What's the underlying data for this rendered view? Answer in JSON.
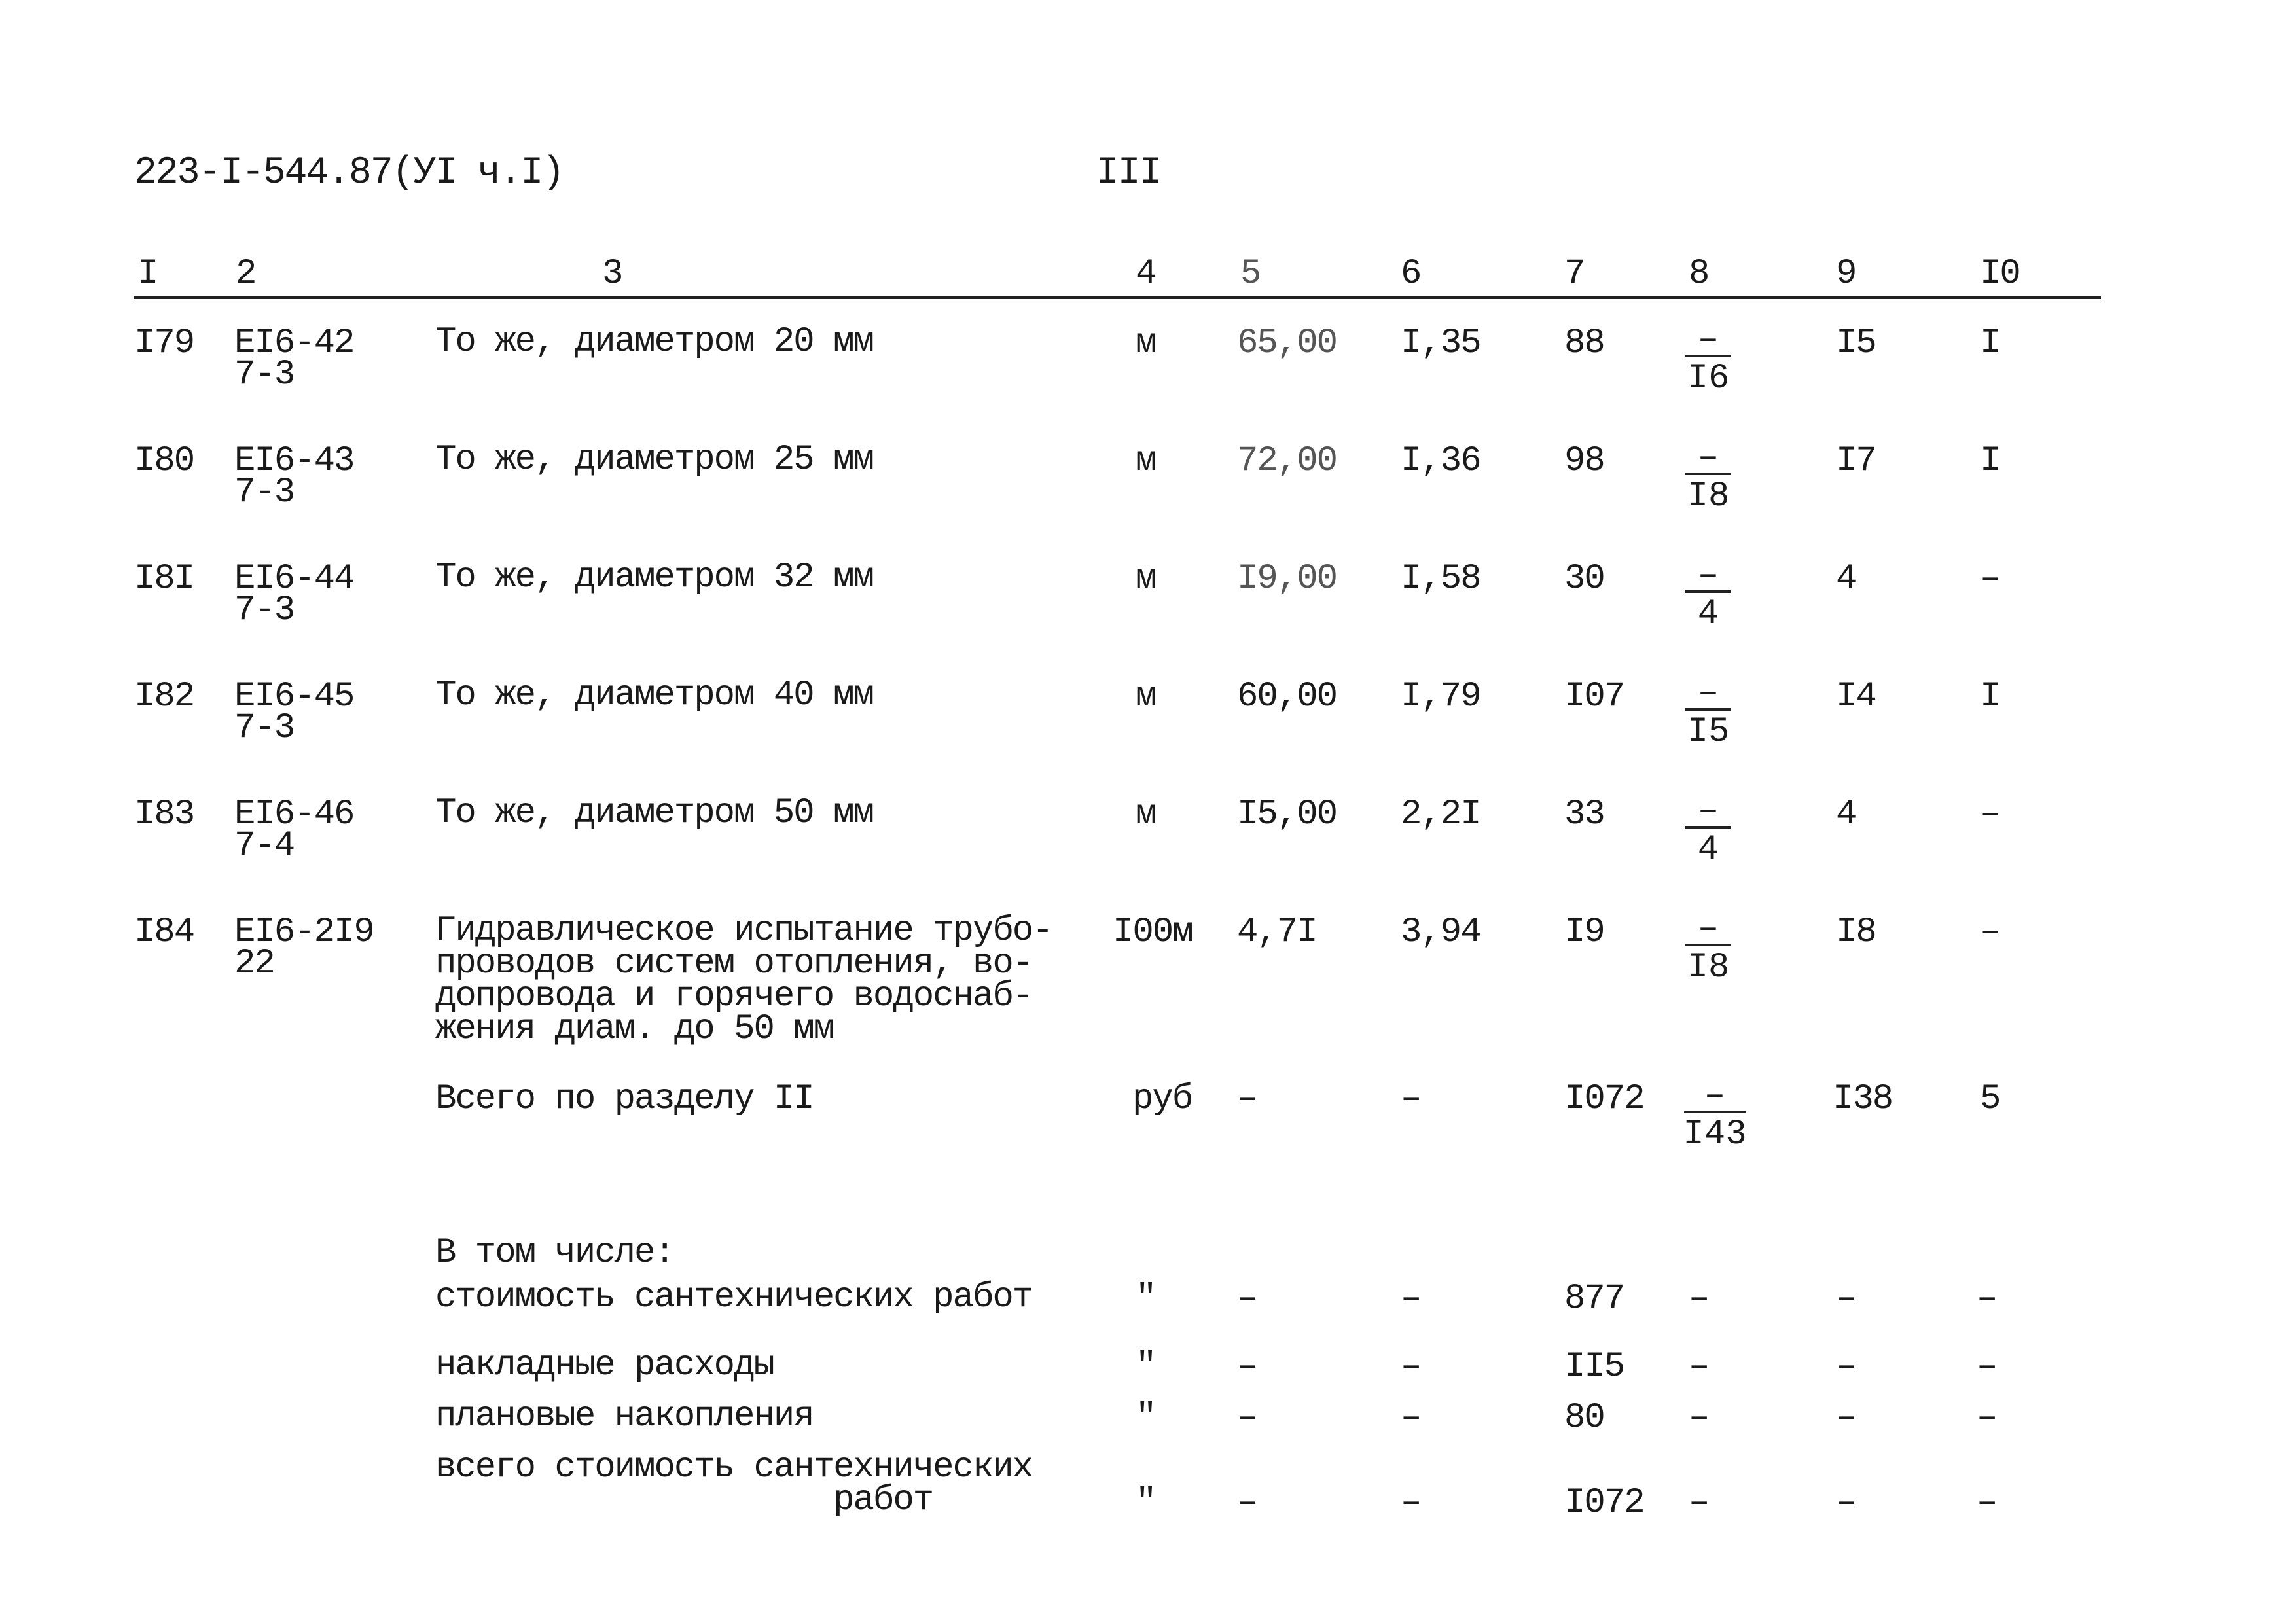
{
  "header": {
    "doc_code": "223-I-544.87(УI ч.I)",
    "page_number": "III"
  },
  "columns": [
    "I",
    "2",
    "3",
    "4",
    "5",
    "6",
    "7",
    "8",
    "9",
    "I0"
  ],
  "rows": [
    {
      "no": "I79",
      "code1": "EI6-42",
      "code2": "7-3",
      "desc": "То же, диаметром 20 мм",
      "unit": "м",
      "c5": "65,00",
      "c6": "I,35",
      "c7": "88",
      "c8_top": "–",
      "c8_bottom": "I6",
      "c9": "I5",
      "c10": "I"
    },
    {
      "no": "I80",
      "code1": "EI6-43",
      "code2": "7-3",
      "desc": "То же, диаметром 25 мм",
      "unit": "м",
      "c5": "72,00",
      "c6": "I,36",
      "c7": "98",
      "c8_top": "–",
      "c8_bottom": "I8",
      "c9": "I7",
      "c10": "I"
    },
    {
      "no": "I8I",
      "code1": "EI6-44",
      "code2": "7-3",
      "desc": "То же, диаметром 32 мм",
      "unit": "м",
      "c5": "I9,00",
      "c6": "I,58",
      "c7": "30",
      "c8_top": "–",
      "c8_bottom": "4",
      "c9": "4",
      "c10": "–"
    },
    {
      "no": "I82",
      "code1": "EI6-45",
      "code2": "7-3",
      "desc": "То же, диаметром 40 мм",
      "unit": "м",
      "c5": "60,00",
      "c6": "I,79",
      "c7": "I07",
      "c8_top": "–",
      "c8_bottom": "I5",
      "c9": "I4",
      "c10": "I"
    },
    {
      "no": "I83",
      "code1": "EI6-46",
      "code2": "7-4",
      "desc": "То же, диаметром 50 мм",
      "unit": "м",
      "c5": "I5,00",
      "c6": "2,2I",
      "c7": "33",
      "c8_top": "–",
      "c8_bottom": "4",
      "c9": "4",
      "c10": "–"
    },
    {
      "no": "I84",
      "code1": "EI6-2I9",
      "code2": "22",
      "desc": "Гидравлическое испытание трубо-\nпроводов систем отопления, во-\nдопровода и горячего водоснаб-\nжения диам. до 50 мм",
      "unit": "I00м",
      "c5": "4,7I",
      "c6": "3,94",
      "c7": "I9",
      "c8_top": "–",
      "c8_bottom": "I8",
      "c9": "I8",
      "c10": "–"
    }
  ],
  "total": {
    "desc": "Всего по разделу II",
    "unit": "руб",
    "c5": "–",
    "c6": "–",
    "c7": "I072",
    "c8_top": "–",
    "c8_bottom": "I43",
    "c9": "I38",
    "c10": "5"
  },
  "breakdown": {
    "heading": "В том числе:",
    "items": [
      {
        "desc": "стоимость сантехнических работ",
        "unit": "\"",
        "c5": "–",
        "c6": "–",
        "c7": "877",
        "c8": "–",
        "c9": "–",
        "c10": "–"
      },
      {
        "desc": "накладные расходы",
        "unit": "\"",
        "c5": "–",
        "c6": "–",
        "c7": "II5",
        "c8": "–",
        "c9": "–",
        "c10": "–"
      },
      {
        "desc": "плановые накопления",
        "unit": "\"",
        "c5": "–",
        "c6": "–",
        "c7": "80",
        "c8": "–",
        "c9": "–",
        "c10": "–"
      },
      {
        "desc": "всего стоимость сантехнических\n                    работ",
        "unit": "\"",
        "c5": "–",
        "c6": "–",
        "c7": "I072",
        "c8": "–",
        "c9": "–",
        "c10": "–"
      }
    ]
  }
}
